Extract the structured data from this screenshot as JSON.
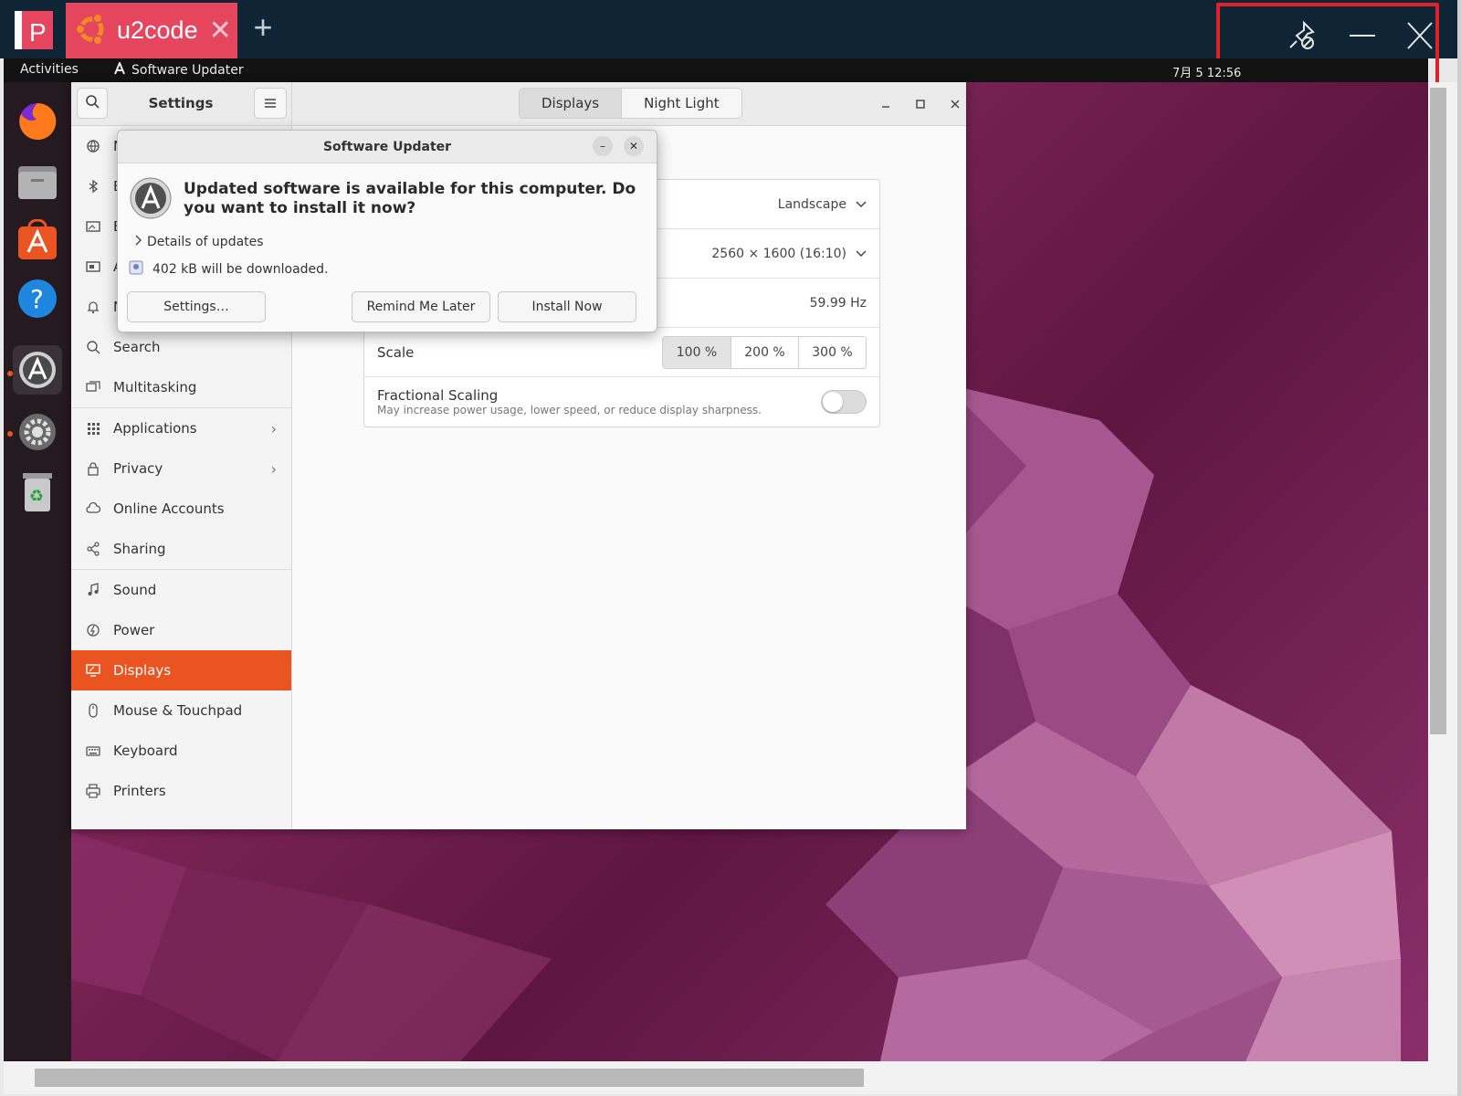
{
  "viewer": {
    "logo_letter": "P",
    "tab_label": "u2code",
    "tab_close": "✕",
    "add_tab": "+",
    "controls": [
      "pin-icon",
      "minimize-icon",
      "close-icon"
    ],
    "highlight_color": "#e2202a",
    "tab_color": "#e6455e"
  },
  "topbar": {
    "activities": "Activities",
    "app_menu": "Software Updater",
    "clock": "7月 5  12:56"
  },
  "dock": {
    "items": [
      "firefox-icon",
      "files-icon",
      "app-center-icon",
      "help-icon",
      "software-updater-icon",
      "settings-icon",
      "trash-icon"
    ]
  },
  "settings": {
    "title": "Settings",
    "tabs": [
      {
        "label": "Displays",
        "active": true
      },
      {
        "label": "Night Light",
        "active": false
      }
    ],
    "sidebar": {
      "items": [
        {
          "label": "N",
          "icon": "network-icon"
        },
        {
          "label": "B",
          "icon": "bluetooth-icon"
        },
        {
          "label": "B",
          "icon": "background-icon"
        },
        {
          "label": "A",
          "icon": "appearance-icon"
        },
        {
          "label": "N",
          "icon": "notifications-icon"
        },
        {
          "label": "Search",
          "icon": "search-icon"
        },
        {
          "label": "Multitasking",
          "icon": "multitasking-icon"
        },
        {
          "label": "Applications",
          "icon": "applications-icon",
          "chevron": "›"
        },
        {
          "label": "Privacy",
          "icon": "privacy-icon",
          "chevron": "›"
        },
        {
          "label": "Online Accounts",
          "icon": "online-accounts-icon"
        },
        {
          "label": "Sharing",
          "icon": "sharing-icon"
        },
        {
          "label": "Sound",
          "icon": "sound-icon"
        },
        {
          "label": "Power",
          "icon": "power-icon"
        },
        {
          "label": "Displays",
          "icon": "displays-icon",
          "active": true
        },
        {
          "label": "Mouse & Touchpad",
          "icon": "mouse-icon"
        },
        {
          "label": "Keyboard",
          "icon": "keyboard-icon"
        },
        {
          "label": "Printers",
          "icon": "printers-icon"
        }
      ]
    },
    "display": {
      "orientation": "Landscape",
      "resolution": "2560 × 1600 (16:10)",
      "refresh_rate": "59.99 Hz",
      "scale_label": "Scale",
      "scale_options": [
        {
          "label": "100 %",
          "active": true
        },
        {
          "label": "200 %",
          "active": false
        },
        {
          "label": "300 %",
          "active": false
        }
      ],
      "fractional_label": "Fractional Scaling",
      "fractional_subtitle": "May increase power usage, lower speed, or reduce display sharpness.",
      "fractional_enabled": false
    }
  },
  "updater": {
    "title": "Software Updater",
    "minimize": "–",
    "close": "✕",
    "heading": "Updated software is available for this computer. Do you want to install it now?",
    "details": "Details of updates",
    "download": "402 kB will be downloaded.",
    "buttons": {
      "settings": "Settings…",
      "remind": "Remind Me Later",
      "install": "Install Now"
    }
  },
  "colors": {
    "accent": "#e95420",
    "topbar": "#121212",
    "dock": "#241a20"
  }
}
